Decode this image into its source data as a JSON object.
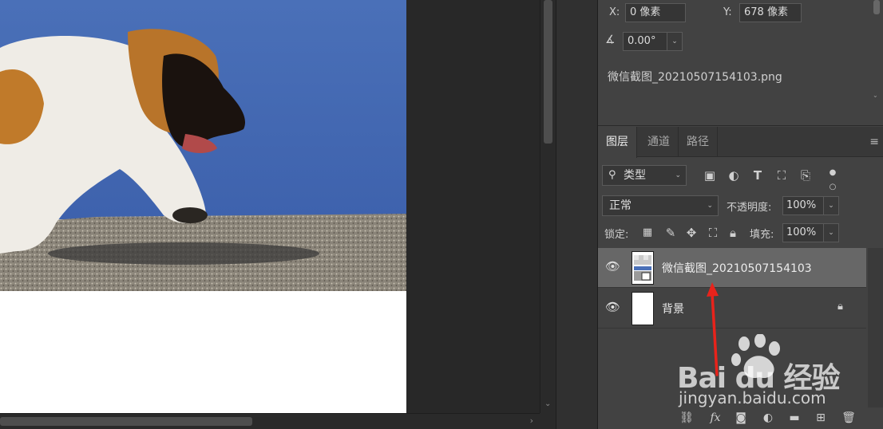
{
  "properties": {
    "x_label": "X:",
    "x_value": "0 像素",
    "y_label": "Y:",
    "y_value": "678 像素",
    "angle_value": "0.00°",
    "filename": "微信截图_20210507154103.png"
  },
  "layers_panel": {
    "tabs": [
      {
        "label": "图层",
        "active": true
      },
      {
        "label": "通道",
        "active": false
      },
      {
        "label": "路径",
        "active": false
      }
    ],
    "filter_type": "类型",
    "blend_mode": "正常",
    "opacity_label": "不透明度:",
    "opacity_value": "100%",
    "lock_label": "锁定:",
    "fill_label": "填充:",
    "fill_value": "100%",
    "layers": [
      {
        "name": "微信截图_20210507154103",
        "selected": true,
        "visible": true,
        "locked": false
      },
      {
        "name": "背景",
        "selected": false,
        "visible": true,
        "locked": true
      }
    ]
  },
  "watermark": {
    "brand": "Bai  du 经验",
    "url": "jingyan.baidu.com"
  },
  "colors": {
    "panel_bg": "#424242",
    "selected_layer": "#676767",
    "annotation_arrow": "#e8231b"
  }
}
